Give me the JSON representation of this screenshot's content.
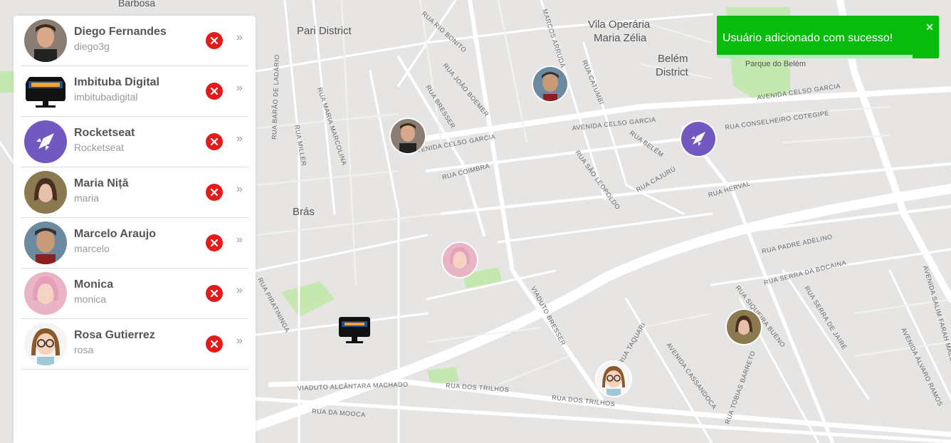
{
  "colors": {
    "map_bg": "#e5e3df",
    "road": "#ffffff",
    "park": "#c5e8b0",
    "remove_btn": "#e51a1a",
    "toast_bg": "#07bc0c",
    "rocket_purple": "#7159c1"
  },
  "map": {
    "labels": [
      "Barbosa",
      "Pari District",
      "Vila Operária",
      "Maria Zélia",
      "Belém",
      "District",
      "Parque do Belém",
      "Brás",
      "AVENIDA CELSO GARCIA",
      "RUA CONSELHEIRO COTEGIPE",
      "RUA COIMBRA",
      "RUA BELÉM",
      "RUA SÃO LEOPOLDO",
      "RUA CAJURÚ",
      "RUA HERVAL",
      "RUA PADRE ADELINO",
      "RUA SERRA DA BOCAINA",
      "RUA SIQUEIRA BUENO",
      "RUA SERRA DE JAIRÉ",
      "VIADUTO BRESSER",
      "AVENIDA CASSANDOCA",
      "RUA TAQUARI",
      "VIADUTO ALCÂNTARA MACHADO",
      "RUA DOS TRILHOS",
      "RUA DA MOOCA",
      "RUA PIRATININGA",
      "RUA BARÃO DE LADÁRIO",
      "RUA MILLER",
      "RUA MARIA MARCOLINA",
      "RUA RIO BONITO",
      "RUA JOÃO BOEMER",
      "RUA BRESSER",
      "MARCOS ARRUDA",
      "RUA CATUMBI",
      "AVENIDA SALIM FARAH MALUF",
      "AVENIDA ÁLVARO RAMOS",
      "RUA TOBIAS BARRETO"
    ]
  },
  "users": [
    {
      "name": "Diego Fernandes",
      "login": "diego3g",
      "avatar_icon": "diego-photo"
    },
    {
      "name": "Imbituba Digital",
      "login": "imbitubadigital",
      "avatar_icon": "monitor-logo"
    },
    {
      "name": "Rocketseat",
      "login": "Rocketseat",
      "avatar_icon": "rocket-logo"
    },
    {
      "name": "Maria Niță",
      "login": "maria",
      "avatar_icon": "maria-photo"
    },
    {
      "name": "Marcelo Araujo",
      "login": "marcelo",
      "avatar_icon": "marcelo-photo"
    },
    {
      "name": "Monica",
      "login": "monica",
      "avatar_icon": "monica-photo"
    },
    {
      "name": "Rosa Gutierrez",
      "login": "rosa",
      "avatar_icon": "rosa-cartoon"
    }
  ],
  "list_controls": {
    "remove_icon": "close-x-icon",
    "arrow_glyph": "»"
  },
  "toast": {
    "message": "Usuário adicionado com sucesso!",
    "close_glyph": "✕",
    "progress": 0.88
  }
}
